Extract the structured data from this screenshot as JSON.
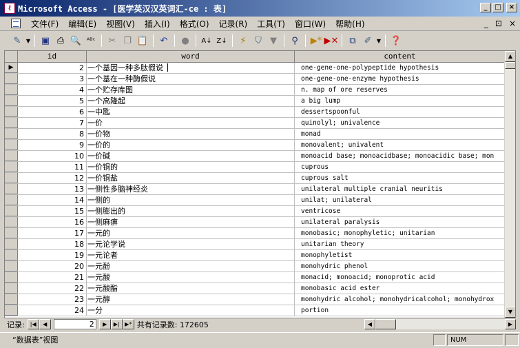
{
  "window": {
    "title": "Microsoft Access - [医学英汉汉英词汇-ce : 表]",
    "controls": [
      "_",
      "□",
      "×"
    ]
  },
  "menu": {
    "items": [
      "文件(F)",
      "编辑(E)",
      "视图(V)",
      "插入(I)",
      "格式(O)",
      "记录(R)",
      "工具(T)",
      "窗口(W)",
      "帮助(H)"
    ],
    "mdi_controls": [
      "_",
      "⊡",
      "×"
    ]
  },
  "toolbar": {
    "icons": [
      "design-view-icon",
      "save-icon",
      "print-icon",
      "print-preview-icon",
      "spelling-icon",
      "cut-icon",
      "copy-icon",
      "paste-icon",
      "undo-icon",
      "hyperlink-icon",
      "sort-ascending-icon",
      "sort-descending-icon",
      "filter-by-selection-icon",
      "filter-by-form-icon",
      "apply-filter-icon",
      "find-icon",
      "new-record-icon",
      "delete-record-icon",
      "database-window-icon",
      "new-object-icon",
      "help-icon"
    ]
  },
  "table": {
    "columns": [
      "id",
      "word",
      "content"
    ],
    "rows": [
      {
        "id": "2",
        "word": "一个基因一种多肽假说",
        "content": "one-gene-one-polypeptide hypothesis"
      },
      {
        "id": "3",
        "word": "一个基在一种酶假说",
        "content": "one-gene-one-enzyme hypothesis"
      },
      {
        "id": "4",
        "word": "一个贮存库图",
        "content": "n. map of ore reserves"
      },
      {
        "id": "5",
        "word": "一个高隆起",
        "content": "a big lump"
      },
      {
        "id": "6",
        "word": "一中匙",
        "content": "dessertspoonful"
      },
      {
        "id": "7",
        "word": "一价",
        "content": "quinolyl; univalence"
      },
      {
        "id": "8",
        "word": "一价物",
        "content": "monad"
      },
      {
        "id": "9",
        "word": "一价的",
        "content": "monovalent; univalent"
      },
      {
        "id": "10",
        "word": "一价碱",
        "content": "monoacid base; monoacidbase; monoacidic base; mon"
      },
      {
        "id": "11",
        "word": "一价铜的",
        "content": "cuprous"
      },
      {
        "id": "12",
        "word": "一价铜盐",
        "content": "cuprous salt"
      },
      {
        "id": "13",
        "word": "一侧性多脑神经炎",
        "content": "unilateral multiple cranial neuritis"
      },
      {
        "id": "14",
        "word": "一侧的",
        "content": "unilat; unilateral"
      },
      {
        "id": "15",
        "word": "一侧膨出的",
        "content": "ventricose"
      },
      {
        "id": "16",
        "word": "一侧麻痹",
        "content": "unilateral paralysis"
      },
      {
        "id": "17",
        "word": "一元的",
        "content": "monobasic; monophyletic; unitarian"
      },
      {
        "id": "18",
        "word": "一元论学说",
        "content": "unitarian theory"
      },
      {
        "id": "19",
        "word": "一元论者",
        "content": "monophyletist"
      },
      {
        "id": "20",
        "word": "一元酚",
        "content": "monohydric phenol"
      },
      {
        "id": "21",
        "word": "一元酸",
        "content": "monacid; monoacid; monoprotic acid"
      },
      {
        "id": "22",
        "word": "一元酸酯",
        "content": "monobasic acid ester"
      },
      {
        "id": "23",
        "word": "一元醇",
        "content": "monohydric alcohol; monohydricalcohol; monohydrox"
      },
      {
        "id": "24",
        "word": "一分",
        "content": "portion"
      }
    ]
  },
  "navigator": {
    "label": "记录:",
    "current": "2",
    "total_label": "共有记录数: 172605"
  },
  "status": {
    "text": "“数据表”视图",
    "indicator": "NUM"
  }
}
